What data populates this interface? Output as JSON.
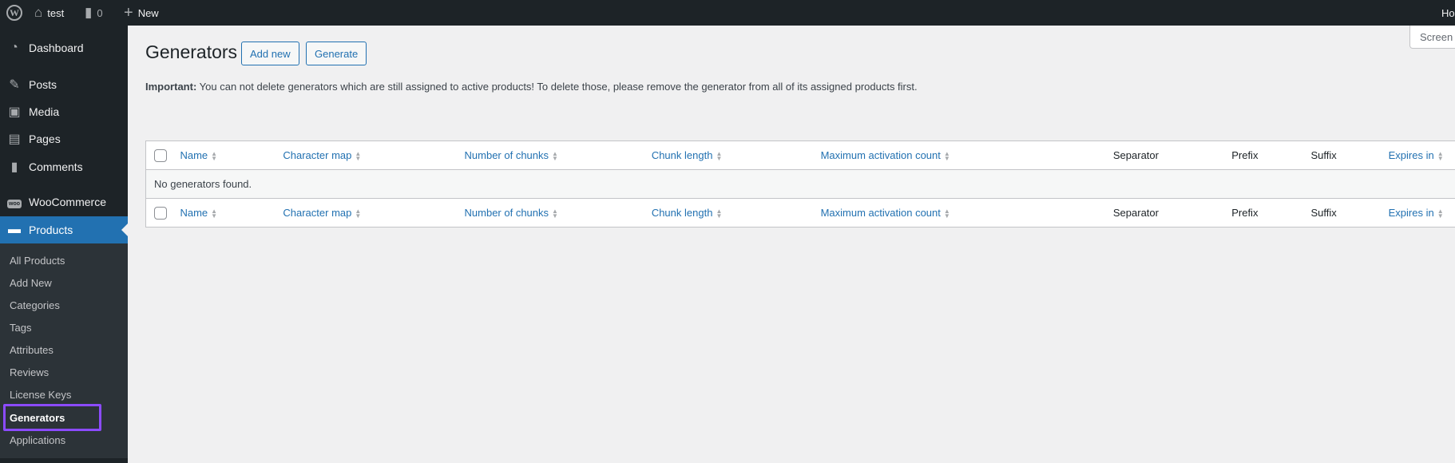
{
  "adminbar": {
    "site": "test",
    "comments": "0",
    "new": "New",
    "howdy": "Ho"
  },
  "sidebar": {
    "items": [
      {
        "label": "Dashboard",
        "icon": "dashboard-icon"
      },
      {
        "label": "Posts",
        "icon": "pin-icon"
      },
      {
        "label": "Media",
        "icon": "media-icon"
      },
      {
        "label": "Pages",
        "icon": "pages-icon"
      },
      {
        "label": "Comments",
        "icon": "comment-icon"
      },
      {
        "label": "WooCommerce",
        "icon": "woo-icon"
      },
      {
        "label": "Products",
        "icon": "archive-icon"
      }
    ],
    "submenu": [
      "All Products",
      "Add New",
      "Categories",
      "Tags",
      "Attributes",
      "Reviews",
      "License Keys",
      "Generators",
      "Applications"
    ]
  },
  "page": {
    "title": "Generators",
    "add_new": "Add new",
    "generate": "Generate",
    "screen_options": "Screen",
    "notice_bold": "Important:",
    "notice": " You can not delete generators which are still assigned to active products! To delete those, please remove the generator from all of its assigned products first."
  },
  "table": {
    "columns": [
      {
        "label": "Name",
        "sortable": true
      },
      {
        "label": "Character map",
        "sortable": true
      },
      {
        "label": "Number of chunks",
        "sortable": true
      },
      {
        "label": "Chunk length",
        "sortable": true
      },
      {
        "label": "Maximum activation count",
        "sortable": true
      },
      {
        "label": "Separator",
        "sortable": false
      },
      {
        "label": "Prefix",
        "sortable": false
      },
      {
        "label": "Suffix",
        "sortable": false
      },
      {
        "label": "Expires in",
        "sortable": true
      }
    ],
    "empty": "No generators found."
  }
}
